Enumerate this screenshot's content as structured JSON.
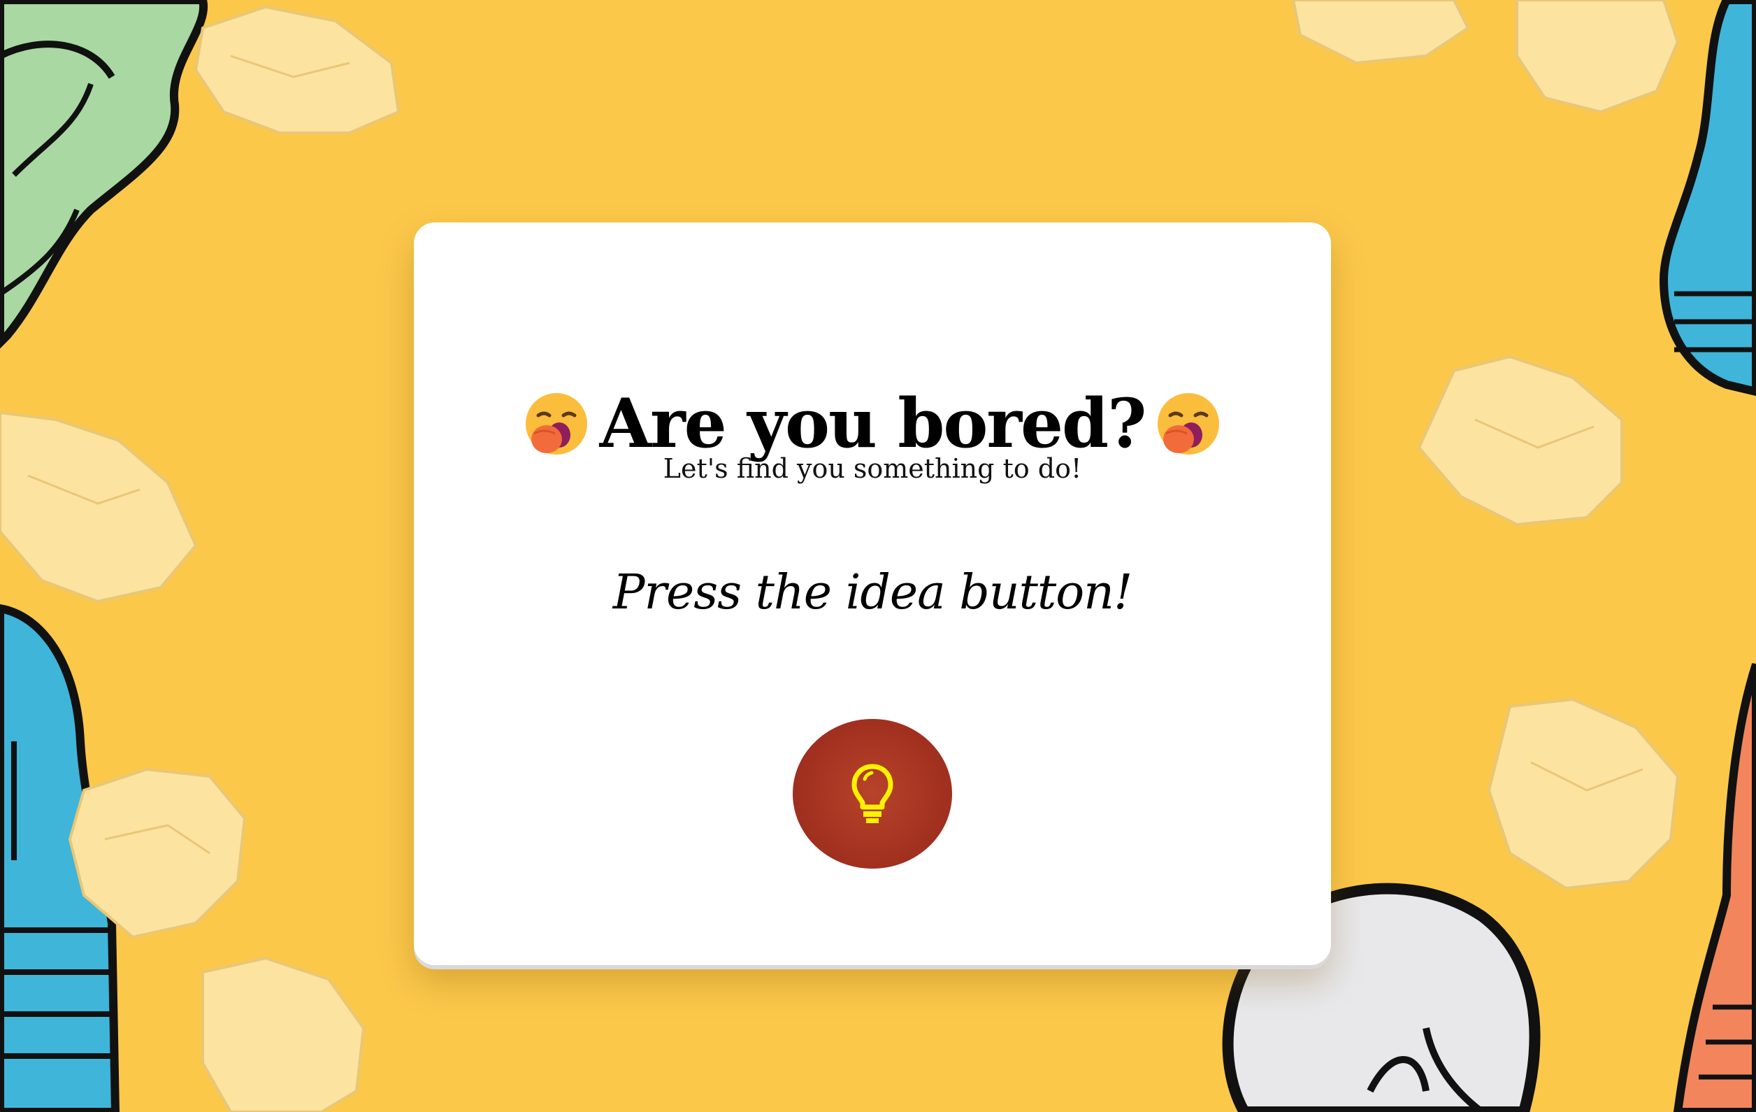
{
  "colors": {
    "background": "#fcc84a",
    "card": "#ffffff",
    "button": "#a9351f",
    "button_icon": "#fff200"
  },
  "header": {
    "emoji_icon": "yawning-face-icon",
    "title": "Are you bored?",
    "subtitle": "Let's find you something to do!"
  },
  "main": {
    "prompt": "Press the idea button!",
    "idea_button_icon": "lightbulb-icon"
  }
}
